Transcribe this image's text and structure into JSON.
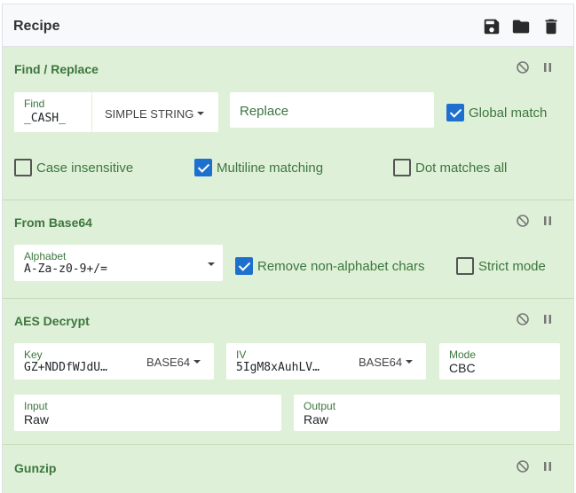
{
  "recipe": {
    "title": "Recipe",
    "icons": [
      "save-icon",
      "folder-icon",
      "trash-icon"
    ]
  },
  "operations": {
    "find_replace": {
      "title": "Find / Replace",
      "find_label": "Find",
      "find_value": "_CASH_",
      "find_type": "SIMPLE STRING",
      "replace_placeholder": "Replace",
      "global_match": {
        "label": "Global match",
        "checked": true
      },
      "case_insensitive": {
        "label": "Case insensitive",
        "checked": false
      },
      "multiline": {
        "label": "Multiline matching",
        "checked": true
      },
      "dot_all": {
        "label": "Dot matches all",
        "checked": false
      }
    },
    "from_base64": {
      "title": "From Base64",
      "alphabet_label": "Alphabet",
      "alphabet_value": "A-Za-z0-9+/=",
      "remove_non_alpha": {
        "label": "Remove non-alphabet chars",
        "checked": true
      },
      "strict_mode": {
        "label": "Strict mode",
        "checked": false
      }
    },
    "aes_decrypt": {
      "title": "AES Decrypt",
      "key_label": "Key",
      "key_value": "GZ+NDDfWJdU…",
      "key_type": "BASE64",
      "iv_label": "IV",
      "iv_value": "5IgM8xAuhLV…",
      "iv_type": "BASE64",
      "mode_label": "Mode",
      "mode_value": "CBC",
      "input_label": "Input",
      "input_value": "Raw",
      "output_label": "Output",
      "output_value": "Raw"
    },
    "gunzip": {
      "title": "Gunzip"
    }
  },
  "colors": {
    "op_background": "#dff0d8",
    "op_text": "#3c763d",
    "checkbox_checked": "#1e70cf"
  }
}
